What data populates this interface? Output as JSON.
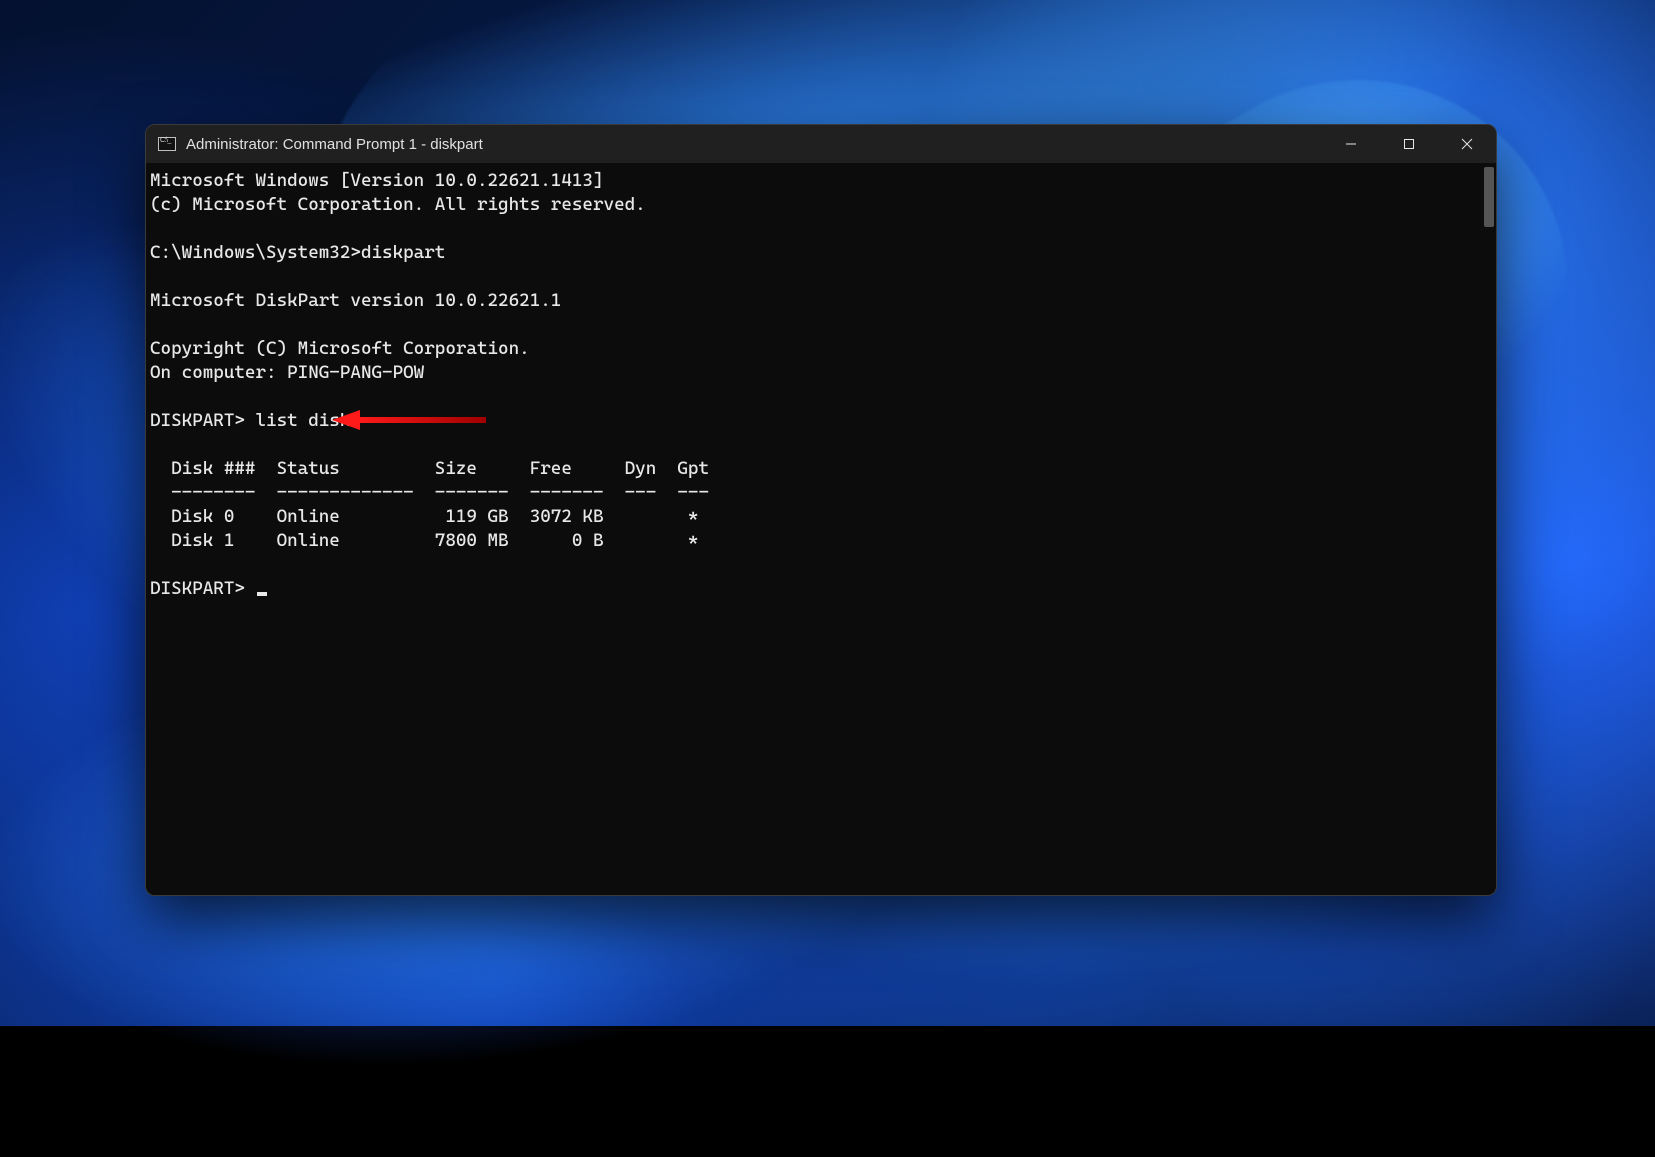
{
  "window": {
    "title": "Administrator: Command Prompt 1 - diskpart"
  },
  "terminal": {
    "line_version": "Microsoft Windows [Version 10.0.22621.1413]",
    "line_copyright": "(c) Microsoft Corporation. All rights reserved.",
    "line_prompt1": "C:\\Windows\\System32>diskpart",
    "line_dp_version": "Microsoft DiskPart version 10.0.22621.1",
    "line_dp_copyright": "Copyright (C) Microsoft Corporation.",
    "line_computer": "On computer: PING-PANG-POW",
    "line_cmd_list": "DISKPART> list disk",
    "table_header": "  Disk ###  Status         Size     Free     Dyn  Gpt",
    "table_divider": "  --------  -------------  -------  -------  ---  ---",
    "table_row_0": "  Disk 0    Online          119 GB  3072 KB        *",
    "table_row_1": "  Disk 1    Online         7800 MB      0 B        *",
    "line_prompt2": "DISKPART> ",
    "disks": [
      {
        "id": "Disk 0",
        "status": "Online",
        "size": "119 GB",
        "free": "3072 KB",
        "dyn": "",
        "gpt": "*"
      },
      {
        "id": "Disk 1",
        "status": "Online",
        "size": "7800 MB",
        "free": "0 B",
        "dyn": "",
        "gpt": "*"
      }
    ]
  },
  "annotation": {
    "arrow_target": "list disk command"
  }
}
